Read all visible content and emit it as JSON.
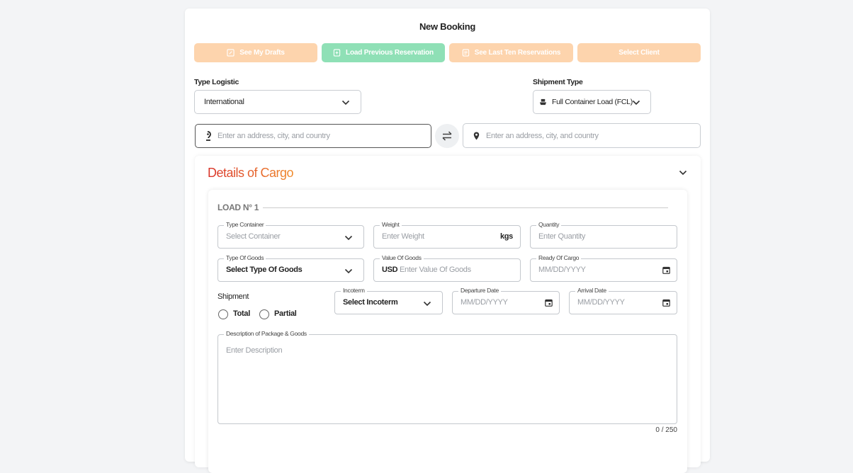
{
  "title": "New Booking",
  "top_buttons": [
    {
      "label": "See My Drafts",
      "icon": "edit-square-icon"
    },
    {
      "label": "Load Previous Reservation",
      "icon": "file-import-icon"
    },
    {
      "label": "See Last Ten Reservations",
      "icon": "list-doc-icon"
    },
    {
      "label": "Select Client"
    }
  ],
  "colors": {
    "orange_btn": "#fdd4ad",
    "green_btn": "#8fe0b6",
    "title_gradient_start": "#d9342b",
    "title_gradient_end": "#f08a2b"
  },
  "type_logistic": {
    "label": "Type Logistic",
    "value": "International"
  },
  "shipment_type": {
    "label": "Shipment Type",
    "value": "Full Container Load (FCL)",
    "icon": "ship-icon"
  },
  "origin": {
    "placeholder": "Enter an address, city, and country",
    "icon": "pin-drop-icon"
  },
  "destination": {
    "placeholder": "Enter an address, city, and country",
    "icon": "location-pin-icon"
  },
  "swap_icon": "swap-arrows-icon",
  "details": {
    "title": "Details of Cargo",
    "load_title": "LOAD N° 1",
    "type_container": {
      "label": "Type Container",
      "placeholder": "Select Container"
    },
    "weight": {
      "label": "Weight",
      "placeholder": "Enter Weight",
      "unit": "kgs"
    },
    "quantity": {
      "label": "Quantity",
      "placeholder": "Enter Quantity"
    },
    "type_goods": {
      "label": "Type Of Goods",
      "value": "Select Type Of Goods"
    },
    "value_goods": {
      "label": "Value Of Goods",
      "currency": "USD",
      "placeholder": "Enter Value Of Goods"
    },
    "ready_cargo": {
      "label": "Ready Of Cargo",
      "placeholder": "MM/DD/YYYY"
    },
    "shipment": {
      "label": "Shipment",
      "options": [
        "Total",
        "Partial"
      ]
    },
    "incoterm": {
      "label": "Incoterm",
      "value": "Select Incoterm"
    },
    "departure": {
      "label": "Departure Date",
      "placeholder": "MM/DD/YYYY"
    },
    "arrival": {
      "label": "Arrival Date",
      "placeholder": "MM/DD/YYYY"
    },
    "description": {
      "label": "Description of Package & Goods",
      "placeholder": "Enter Description",
      "counter": "0 / 250"
    }
  }
}
